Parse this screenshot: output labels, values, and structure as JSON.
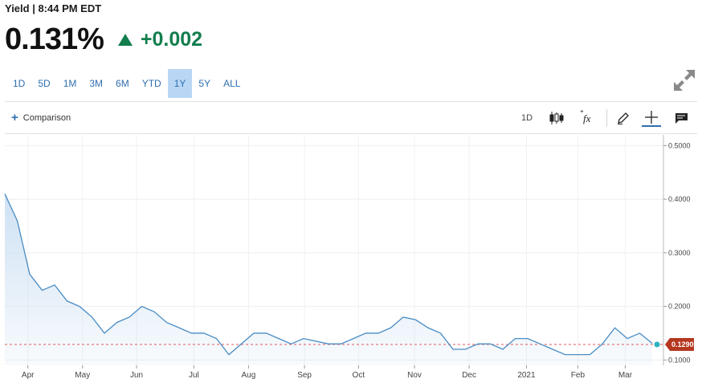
{
  "header": {
    "label": "Yield | 8:44 PM EDT",
    "price": "0.131%",
    "change": "+0.002",
    "change_color": "#127e4e"
  },
  "range_tabs": [
    {
      "label": "1D",
      "active": false
    },
    {
      "label": "5D",
      "active": false
    },
    {
      "label": "1M",
      "active": false
    },
    {
      "label": "3M",
      "active": false
    },
    {
      "label": "6M",
      "active": false
    },
    {
      "label": "YTD",
      "active": false
    },
    {
      "label": "1Y",
      "active": true
    },
    {
      "label": "5Y",
      "active": false
    },
    {
      "label": "ALL",
      "active": false
    }
  ],
  "toolbar": {
    "comparison_label": "Comparison",
    "interval_label": "1D",
    "icons": [
      "candlestick-icon",
      "studies-fx-icon",
      "draw-pencil-icon",
      "crosshair-icon",
      "event-flag-icon"
    ],
    "expand_icon": "expand-arrows-icon"
  },
  "colors": {
    "line": "#4a8cc4",
    "area_top": "#c9def2",
    "accent": "#2f6fb0",
    "last_value_label": "#b5371f",
    "last_value_marker": "#2bb3c0"
  },
  "chart_data": {
    "type": "area",
    "x_unit": "week",
    "x": [
      "2020-03-22",
      "2020-03-29",
      "2020-04-05",
      "2020-04-12",
      "2020-04-19",
      "2020-04-26",
      "2020-05-03",
      "2020-05-10",
      "2020-05-17",
      "2020-05-24",
      "2020-05-31",
      "2020-06-07",
      "2020-06-14",
      "2020-06-21",
      "2020-06-28",
      "2020-07-05",
      "2020-07-12",
      "2020-07-19",
      "2020-07-26",
      "2020-08-02",
      "2020-08-09",
      "2020-08-16",
      "2020-08-23",
      "2020-08-30",
      "2020-09-06",
      "2020-09-13",
      "2020-09-20",
      "2020-09-27",
      "2020-10-04",
      "2020-10-11",
      "2020-10-18",
      "2020-10-25",
      "2020-11-01",
      "2020-11-08",
      "2020-11-15",
      "2020-11-22",
      "2020-11-29",
      "2020-12-06",
      "2020-12-13",
      "2020-12-20",
      "2020-12-27",
      "2021-01-03",
      "2021-01-10",
      "2021-01-17",
      "2021-01-24",
      "2021-01-31",
      "2021-02-07",
      "2021-02-14",
      "2021-02-21",
      "2021-02-28",
      "2021-03-07",
      "2021-03-14",
      "2021-03-21"
    ],
    "series": [
      {
        "values": [
          0.41,
          0.36,
          0.26,
          0.23,
          0.24,
          0.21,
          0.2,
          0.18,
          0.15,
          0.17,
          0.18,
          0.2,
          0.19,
          0.17,
          0.16,
          0.15,
          0.15,
          0.14,
          0.11,
          0.13,
          0.15,
          0.15,
          0.14,
          0.13,
          0.14,
          0.135,
          0.13,
          0.13,
          0.14,
          0.15,
          0.15,
          0.16,
          0.18,
          0.175,
          0.16,
          0.15,
          0.12,
          0.12,
          0.13,
          0.13,
          0.12,
          0.14,
          0.14,
          0.13,
          0.12,
          0.11,
          0.11,
          0.11,
          0.13,
          0.16,
          0.14,
          0.15,
          0.131
        ]
      }
    ],
    "y_ticks": [
      "0.1000",
      "0.2000",
      "0.3000",
      "0.4000",
      "0.5000"
    ],
    "ylim": [
      0.09,
      0.52
    ],
    "x_tick_labels": [
      "Apr",
      "May",
      "Jun",
      "Jul",
      "Aug",
      "Sep",
      "Oct",
      "Nov",
      "Dec",
      "2021",
      "Feb",
      "Mar"
    ],
    "last_value_label": "0.1290",
    "reference_line": 0.129,
    "grid": true
  }
}
